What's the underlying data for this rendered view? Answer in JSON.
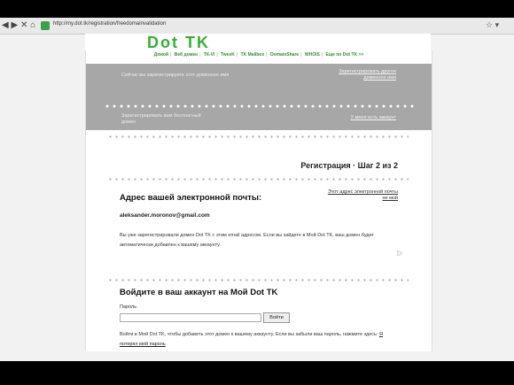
{
  "browser": {
    "nav": "◀ ▶ ✕ ⌂",
    "url": "http://my.dot.tk/registration/freedomainvalidation",
    "right_icons": "☆ ▾"
  },
  "page": {
    "logo": "Dot TK",
    "nav_links": [
      "Домой",
      "Веб домен",
      "ТК-VI",
      "TweeK",
      "TK Mailbox",
      "DomainShare",
      "WHOIS",
      "Еще по Dot TK >>"
    ],
    "banner": {
      "left_top": "Сейчас вы зарегистрируете этот доменное имя",
      "right_top": "Зарегистрировать другое доменное имя",
      "left_bottom": "Зарегистрировать вам бесплатный домен",
      "right_bottom": "У меня есть аккаунт"
    },
    "step": "Регистрация · Шаг 2 из 2",
    "email": {
      "title": "Адрес вашей электронной почты:",
      "value": "aleksander.moronov@gmail.com",
      "change_link": "Этот адрес электронной почты не мой",
      "note": "Вы уже зарегистрировали домен Dot TK с этим email адресом. Если вы зайдете в Мой Dot TK, ваш домен будет автоматически добавлен к вашему аккаунту."
    },
    "login": {
      "title": "Войдите в ваш аккаунт на Мой Dot TK",
      "password_label": "Пароль",
      "password_value": "",
      "button": "Войти",
      "note": "Войти в Мой Dot TK, чтобы добавить этот домен к вашему аккаунту. Если вы забыли ваш пароль, нажмите здесь:",
      "forgot_link": "Я потерял мой пароль"
    }
  }
}
